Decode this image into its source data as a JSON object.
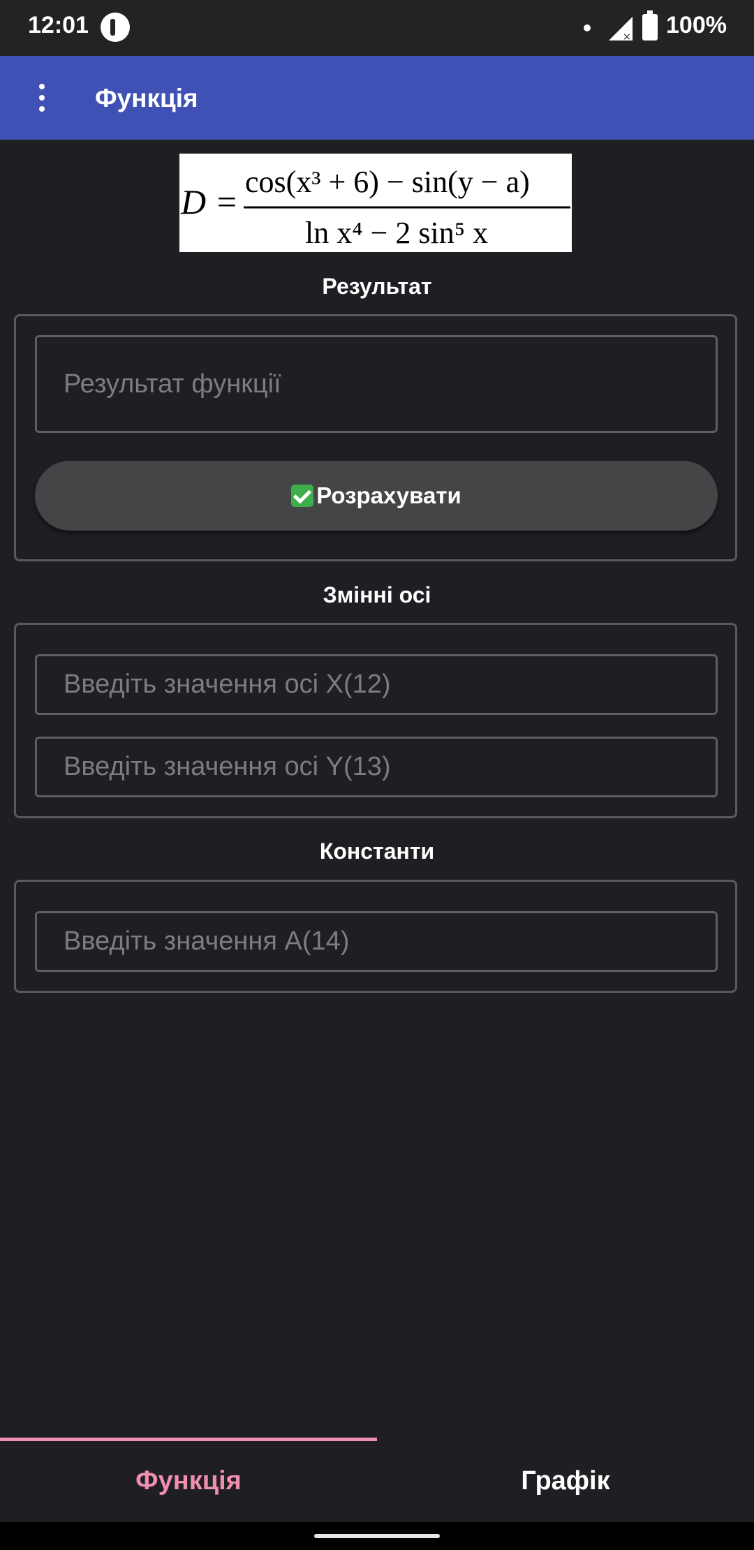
{
  "status_bar": {
    "time": "12:01",
    "battery": "100%"
  },
  "app_bar": {
    "title": "Функція"
  },
  "formula": {
    "numerator": "cos(x³ + 6) − sin(y − a)",
    "denominator": "ln x⁴ − 2 sin⁵ x",
    "lhs": "D ="
  },
  "result_section": {
    "title": "Результат",
    "result_placeholder": "Результат функції",
    "calculate_label": "Розрахувати"
  },
  "axes_section": {
    "title": "Змінні осі",
    "x_placeholder": "Введіть значення осі X(12)",
    "y_placeholder": "Введіть значення осі Y(13)"
  },
  "constants_section": {
    "title": "Константи",
    "a_placeholder": "Введіть значення A(14)"
  },
  "tabs": [
    {
      "label": "Функція",
      "active": true
    },
    {
      "label": "Графік",
      "active": false
    }
  ],
  "colors": {
    "app_bar": "#3f51b5",
    "background": "#1f1f23",
    "active_tab": "#ef8fb0"
  }
}
